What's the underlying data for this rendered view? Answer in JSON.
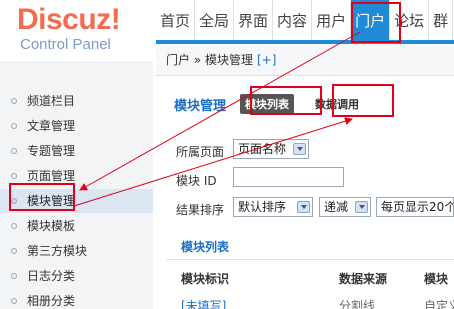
{
  "logo": {
    "brand": "Discuz!",
    "subtitle": "Control Panel"
  },
  "topnav": {
    "tabs": [
      "首页",
      "全局",
      "界面",
      "内容",
      "用户",
      "门户",
      "论坛",
      "群"
    ],
    "active": "门户"
  },
  "breadcrumb": {
    "text": "门户 » 模块管理",
    "add_label": "[+]"
  },
  "sidebar": {
    "items": [
      "频道栏目",
      "文章管理",
      "专题管理",
      "页面管理",
      "模块管理",
      "模块模板",
      "第三方模块",
      "日志分类",
      "相册分类"
    ],
    "active": "模块管理"
  },
  "main": {
    "title": "模块管理",
    "tab_active": "模块列表",
    "tab_other": "数据调用",
    "filters": {
      "page_label": "所属页面",
      "page_value": "页面名称",
      "id_label": "模块 ID",
      "sort_label": "结果排序",
      "sort_value": "默认排序",
      "order_value": "递减",
      "perpage_value": "每页显示20个"
    },
    "list_title": "模块列表",
    "columns": [
      "模块标识",
      "数据来源",
      "模块"
    ],
    "first_row": [
      "[未填写]",
      "分割线",
      "自定义"
    ]
  },
  "colors": {
    "accent": "#1f8ad6",
    "annotation": "#e0001a"
  }
}
